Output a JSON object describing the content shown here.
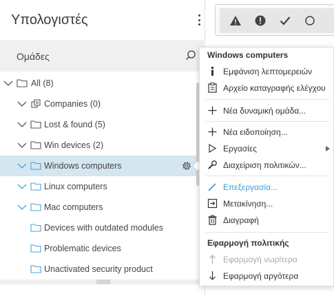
{
  "panel": {
    "title": "Υπολογιστές",
    "groups_label": "Ομάδες"
  },
  "tree": [
    {
      "label": "All (8)"
    },
    {
      "label": "Companies (0)"
    },
    {
      "label": "Lost & found (5)"
    },
    {
      "label": "Win devices (2)"
    },
    {
      "label": "Windows computers"
    },
    {
      "label": "Linux computers"
    },
    {
      "label": "Mac computers"
    },
    {
      "label": "Devices with outdated modules"
    },
    {
      "label": "Problematic devices"
    },
    {
      "label": "Unactivated security product"
    }
  ],
  "menu": {
    "heading": "Windows computers",
    "items": [
      {
        "label": "Εμφάνιση λεπτομερειών",
        "icon": "info-icon"
      },
      {
        "label": "Αρχείο καταγραφής ελέγχου",
        "icon": "audit-log-icon"
      },
      {
        "label": "Νέα δυναμική ομάδα...",
        "icon": "plus-icon"
      },
      {
        "label": "Νέα ειδοποίηση...",
        "icon": "plus-icon"
      },
      {
        "label": "Εργασίες",
        "icon": "play-icon"
      },
      {
        "label": "Διαχείριση πολιτικών...",
        "icon": "wrench-icon"
      },
      {
        "label": "Επεξεργασία...",
        "icon": "pencil-icon"
      },
      {
        "label": "Μετακίνηση...",
        "icon": "move-icon"
      },
      {
        "label": "Διαγραφή",
        "icon": "trash-icon"
      }
    ],
    "policy_heading": "Εφαρμογή πολιτικής",
    "policy_items": [
      {
        "label": "Εφαρμογή νωρίτερα",
        "icon": "arrow-up-icon"
      },
      {
        "label": "Εφαρμογή αργότερα",
        "icon": "arrow-down-icon"
      }
    ]
  },
  "colors": {
    "selected_row": "#d4e6ef",
    "folder_blue": "#4aa3d8",
    "active_item": "#3b9fd3"
  }
}
